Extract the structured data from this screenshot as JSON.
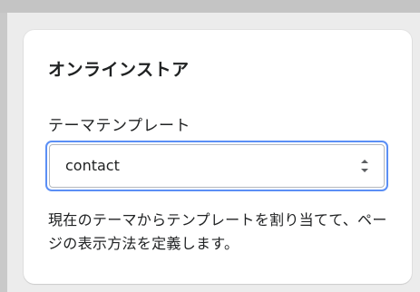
{
  "card": {
    "title": "オンラインストア",
    "field_label": "テーマテンプレート",
    "select_value": "contact",
    "help_text": "現在のテーマからテンプレートを割り当てて、ページの表示方法を定義します。"
  },
  "icons": {
    "select_arrows": "chevron-up-down-icon"
  },
  "colors": {
    "focus_ring": "#5b8ff5",
    "card_background": "#ffffff",
    "page_background": "#ececec",
    "text": "#202223"
  }
}
